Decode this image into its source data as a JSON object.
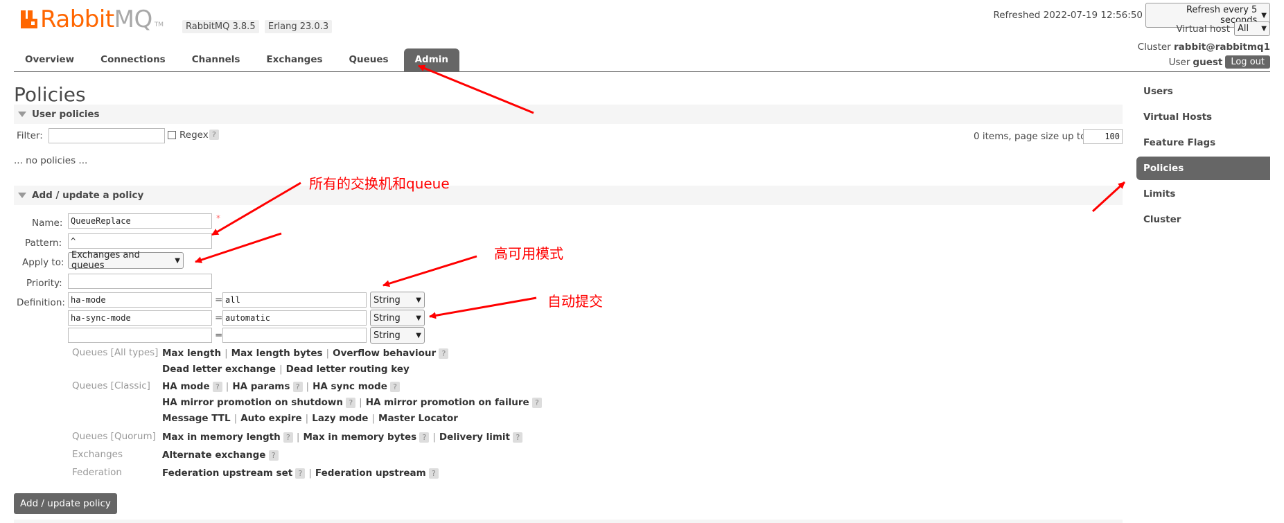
{
  "header": {
    "logo_rabbit": "Rabbit",
    "logo_mq": "MQ",
    "logo_tm": "TM",
    "version_rabbitmq": "RabbitMQ 3.8.5",
    "version_erlang": "Erlang 23.0.3",
    "refreshed_label": "Refreshed 2022-07-19 12:56:50",
    "refresh_select": "Refresh every 5 seconds",
    "vhost_label": "Virtual host",
    "vhost_select": "All",
    "cluster_label": "Cluster",
    "cluster_value": "rabbit@rabbitmq1",
    "user_label": "User",
    "user_value": "guest",
    "logout_label": "Log out"
  },
  "tabs": [
    {
      "label": "Overview"
    },
    {
      "label": "Connections"
    },
    {
      "label": "Channels"
    },
    {
      "label": "Exchanges"
    },
    {
      "label": "Queues"
    },
    {
      "label": "Admin",
      "active": true
    }
  ],
  "page": {
    "title": "Policies",
    "user_policies": {
      "title": "User policies",
      "filter_label": "Filter:",
      "filter_value": "",
      "regex_label": "Regex",
      "help": "?",
      "pager_label": "0 items, page size up to",
      "page_size": "100",
      "empty_text": "... no policies ..."
    },
    "add_policy": {
      "title": "Add / update a policy",
      "name_label": "Name:",
      "name_value": "QueueReplace",
      "required_mark": "*",
      "pattern_label": "Pattern:",
      "pattern_value": "^",
      "apply_label": "Apply to:",
      "apply_value": "Exchanges and queues",
      "priority_label": "Priority:",
      "priority_value": "",
      "definition_label": "Definition:",
      "eq": "=",
      "definitions": [
        {
          "key": "ha-mode",
          "value": "all",
          "type": "String"
        },
        {
          "key": "ha-sync-mode",
          "value": "automatic",
          "type": "String"
        },
        {
          "key": "",
          "value": "",
          "type": "String"
        }
      ],
      "cat_all": "Queues [All types]",
      "cat_classic": "Queues [Classic]",
      "cat_quorum": "Queues [Quorum]",
      "cat_exchanges": "Exchanges",
      "cat_federation": "Federation",
      "k_max_length": "Max length",
      "k_max_length_bytes": "Max length bytes",
      "k_overflow": "Overflow behaviour",
      "k_dlx": "Dead letter exchange",
      "k_dlrk": "Dead letter routing key",
      "k_ha_mode": "HA mode",
      "k_ha_params": "HA params",
      "k_ha_sync": "HA sync mode",
      "k_ha_shutdown": "HA mirror promotion on shutdown",
      "k_ha_failure": "HA mirror promotion on failure",
      "k_msg_ttl": "Message TTL",
      "k_auto_expire": "Auto expire",
      "k_lazy": "Lazy mode",
      "k_master_locator": "Master Locator",
      "k_max_mem_len": "Max in memory length",
      "k_max_mem_bytes": "Max in memory bytes",
      "k_delivery_limit": "Delivery limit",
      "k_alt_exchange": "Alternate exchange",
      "k_fed_set": "Federation upstream set",
      "k_fed_up": "Federation upstream",
      "sep": "|",
      "submit_label": "Add / update policy"
    }
  },
  "sidebar": [
    {
      "label": "Users"
    },
    {
      "label": "Virtual Hosts"
    },
    {
      "label": "Feature Flags"
    },
    {
      "label": "Policies",
      "active": true
    },
    {
      "label": "Limits"
    },
    {
      "label": "Cluster"
    }
  ],
  "annotations": {
    "note_all": "所有的交换机和queue",
    "note_ha": "高可用模式",
    "note_sync": "自动提交",
    "color": "#ff0000"
  },
  "colors": {
    "brand": "#ff6600",
    "tab_active": "#666666"
  }
}
